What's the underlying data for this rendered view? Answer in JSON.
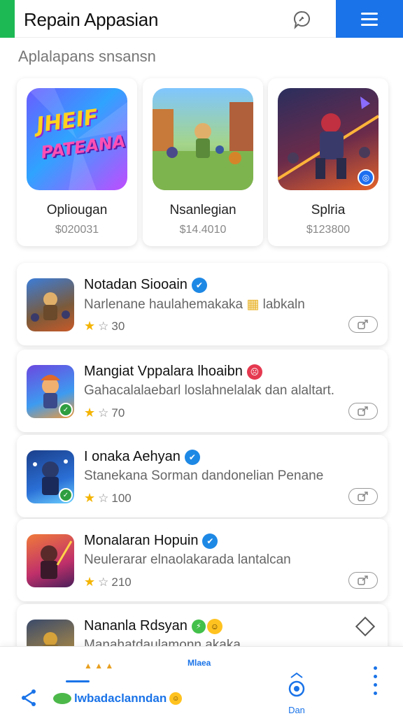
{
  "header": {
    "title": "Repain Appasian",
    "chat_icon": "chat-bubble-icon",
    "menu_icon": "hamburger-menu-icon"
  },
  "section": {
    "heading": "Aplalapans snsansn"
  },
  "featured": [
    {
      "name": "Opliougan",
      "price": "$020031",
      "art_text_1": "JHEIF",
      "art_text_2": "PATEANA"
    },
    {
      "name": "Nsanlegian",
      "price": "$14.4010"
    },
    {
      "name": "Splria",
      "price": "$123800"
    }
  ],
  "list": [
    {
      "title": "Notadan Siooain",
      "desc": "Narlenane haulahemakaka",
      "desc_tail": "labkaln",
      "rating": "30",
      "badge": "verified"
    },
    {
      "title": "Mangiat Vppalara lhoaibn",
      "desc": "Gahacalalaebarl loslahnelalak dan alaltart.",
      "rating": "70",
      "badge": "red-emoji"
    },
    {
      "title": "I onaka Aehyan",
      "desc": "Stanekana Sorman dandonelian Penane",
      "rating": "100",
      "badge": "verified"
    },
    {
      "title": "Monalaran Hopuin",
      "desc": "Neulerarar elnaolakarada lantalcan",
      "rating": "210",
      "badge": "verified"
    },
    {
      "title": "Nananla Rdsyan",
      "desc": "Manahatdaulamonn akaka",
      "badge": "green-yellow-emoji"
    }
  ],
  "bottom_bar": {
    "peek_label": "Mlaea",
    "brand": "lwbadaclanndan",
    "nav_label": "Dan"
  },
  "colors": {
    "accent_green": "#1db954",
    "primary_blue": "#1a73e8",
    "star": "#f4b400"
  }
}
